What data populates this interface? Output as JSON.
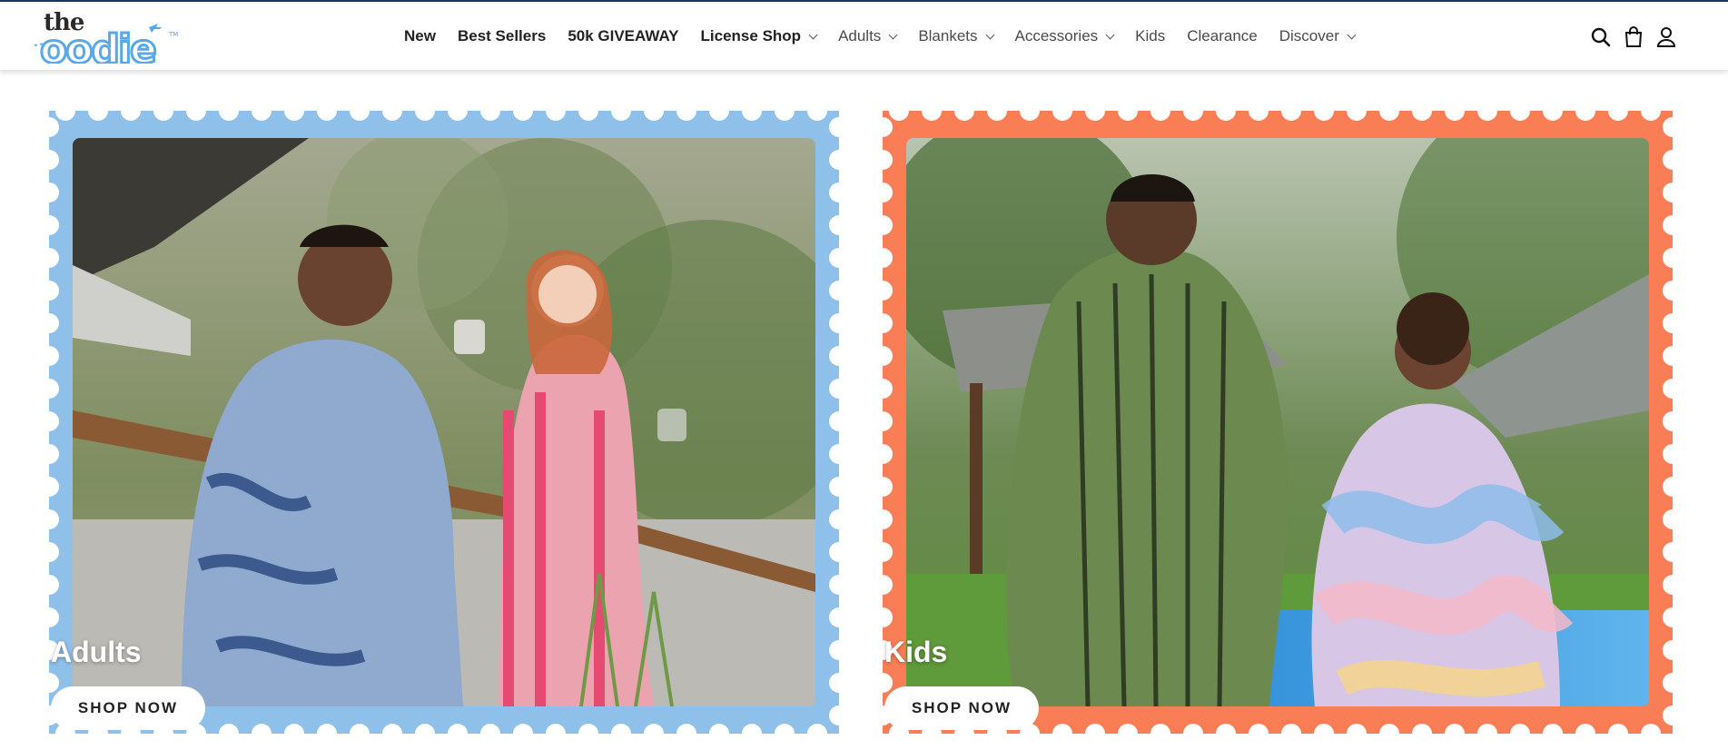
{
  "brand": {
    "logo_word_top": "the",
    "logo_word_main": "oodie"
  },
  "nav": {
    "items": [
      {
        "label": "New",
        "bold": true,
        "dropdown": false
      },
      {
        "label": "Best Sellers",
        "bold": true,
        "dropdown": false
      },
      {
        "label": "50k GIVEAWAY",
        "bold": true,
        "dropdown": false
      },
      {
        "label": "License Shop",
        "bold": true,
        "dropdown": true
      },
      {
        "label": "Adults",
        "bold": false,
        "dropdown": true
      },
      {
        "label": "Blankets",
        "bold": false,
        "dropdown": true
      },
      {
        "label": "Accessories",
        "bold": false,
        "dropdown": true
      },
      {
        "label": "Kids",
        "bold": false,
        "dropdown": false
      },
      {
        "label": "Clearance",
        "bold": false,
        "dropdown": false
      },
      {
        "label": "Discover",
        "bold": false,
        "dropdown": true
      }
    ]
  },
  "header_icons": [
    "search-icon",
    "cart-icon",
    "account-icon"
  ],
  "cards": [
    {
      "title": "Adults",
      "button_label": "SHOP NOW",
      "frame_color": "#8fc0ea"
    },
    {
      "title": "Kids",
      "button_label": "SHOP NOW",
      "frame_color": "#f97e56"
    }
  ],
  "colors": {
    "brand_blue": "#5aa8e6",
    "top_line": "#0f3a63"
  }
}
